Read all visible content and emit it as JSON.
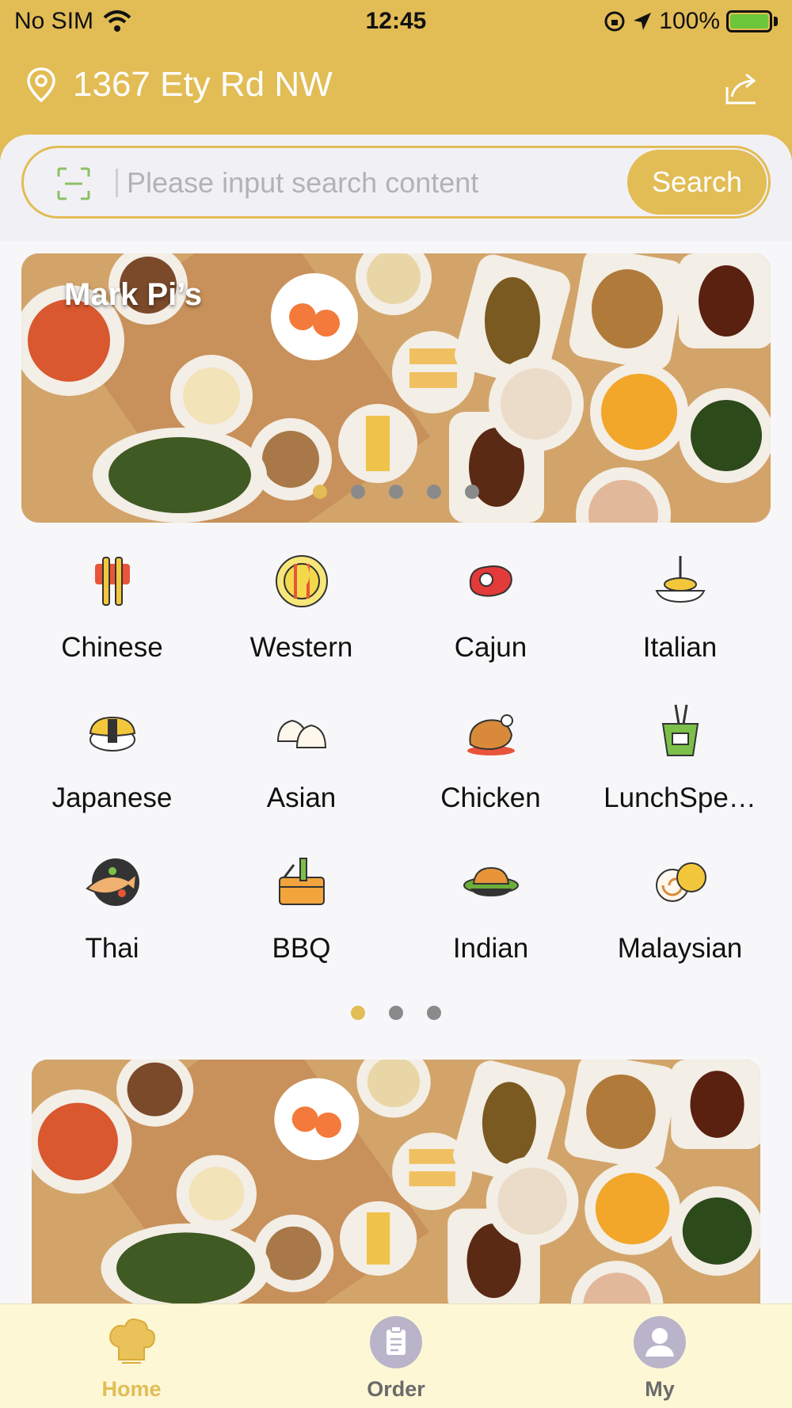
{
  "status_bar": {
    "carrier": "No SIM",
    "time": "12:45",
    "battery": "100%"
  },
  "header": {
    "location": "1367 Ety Rd NW",
    "icons": [
      "location-pin-icon",
      "share-icon"
    ]
  },
  "search": {
    "placeholder": "Please input search content",
    "value": "",
    "button_label": "Search",
    "scan_icon": "scan-icon"
  },
  "banner": {
    "title": "Mark Pi’s",
    "slide_count": 5,
    "active_slide": 1
  },
  "categories": {
    "items": [
      {
        "label": "Chinese",
        "icon": "chopsticks-icon"
      },
      {
        "label": "Western",
        "icon": "plate-fork-knife-icon"
      },
      {
        "label": "Cajun",
        "icon": "steak-icon"
      },
      {
        "label": "Italian",
        "icon": "pasta-icon"
      },
      {
        "label": "Japanese",
        "icon": "sushi-icon"
      },
      {
        "label": "Asian",
        "icon": "dumplings-icon"
      },
      {
        "label": "Chicken",
        "icon": "roast-chicken-icon"
      },
      {
        "label": "LunchSpe…",
        "icon": "takeout-box-icon"
      },
      {
        "label": "Thai",
        "icon": "fish-dish-icon"
      },
      {
        "label": "BBQ",
        "icon": "bbq-basket-icon"
      },
      {
        "label": "Indian",
        "icon": "curry-bowl-icon"
      },
      {
        "label": "Malaysian",
        "icon": "swiss-roll-icon"
      }
    ],
    "page_count": 3,
    "active_page": 1
  },
  "tabbar": {
    "tabs": [
      {
        "label": "Home",
        "icon": "chef-hat-icon",
        "active": true
      },
      {
        "label": "Order",
        "icon": "clipboard-icon",
        "active": false
      },
      {
        "label": "My",
        "icon": "user-icon",
        "active": false
      }
    ]
  },
  "colors": {
    "accent": "#e2bc55",
    "tabbar_bg": "#fdf7d6",
    "inactive_dot": "#8a8a8a"
  }
}
